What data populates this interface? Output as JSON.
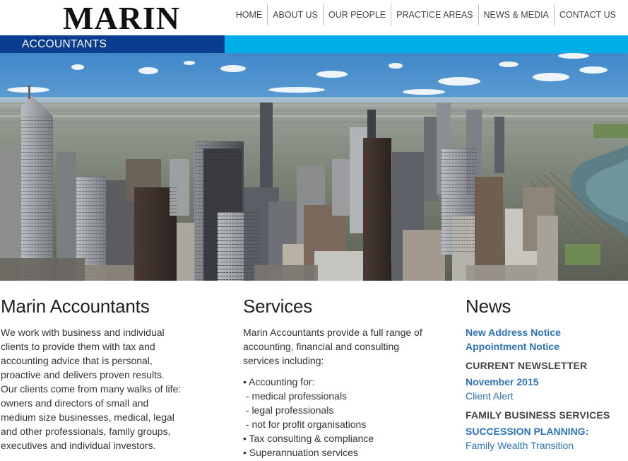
{
  "brand": {
    "logo": "MARIN",
    "subtitle": "ACCOUNTANTS",
    "colors": {
      "dark_blue": "#0a3d8f",
      "light_blue": "#00aee8",
      "link_blue": "#2d73b9"
    }
  },
  "nav": {
    "items": [
      {
        "label": "HOME"
      },
      {
        "label": "ABOUT US"
      },
      {
        "label": "OUR PEOPLE"
      },
      {
        "label": "PRACTICE AREAS"
      },
      {
        "label": "NEWS & MEDIA"
      },
      {
        "label": "CONTACT US"
      }
    ]
  },
  "intro": {
    "heading": "Marin Accountants",
    "lines": [
      "We work with business and individual",
      "clients to provide them with tax and",
      "accounting advice that is personal,",
      "proactive and delivers proven results.",
      "Our clients come from many walks of life:",
      "owners and directors of small and",
      "medium size businesses, medical, legal",
      "and other professionals, family groups,",
      "executives and individual investors."
    ]
  },
  "services": {
    "heading": "Services",
    "lines": [
      "Marin Accountants provide a full range of",
      "accounting, financial and consulting",
      "services including:"
    ],
    "items": [
      "• Accounting for:",
      " - medical professionals",
      " - legal professionals",
      " - not for profit organisations",
      "• Tax consulting & compliance",
      "• Superannuation services"
    ]
  },
  "news": {
    "heading": "News",
    "links": [
      {
        "label": "New Address Notice"
      },
      {
        "label": "Appointment Notice"
      }
    ],
    "newsletter_heading": "CURRENT NEWSLETTER",
    "newsletter_month": "November 2015",
    "newsletter_link": "Client Alert",
    "family_heading": "FAMILY BUSINESS SERVICES",
    "family_sub": "SUCCESSION PLANNING:",
    "family_link": "Family Wealth Transition"
  }
}
